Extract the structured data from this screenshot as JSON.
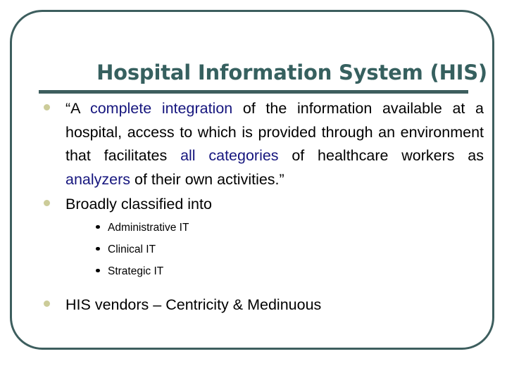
{
  "slide": {
    "title": "Hospital Information System (HIS)",
    "frame_color": "#3d5e5e",
    "title_color": "#36605f",
    "bullet_color": "#cccc99",
    "highlight_color": "#16167e",
    "body_color": "#000000",
    "background_color": "#ffffff"
  },
  "quote": {
    "open_quote": "“A ",
    "hl_complete_integration": "complete integration",
    "mid_1": " of the information available at a hospital, access to which is provided through an environment that facilitates ",
    "hl_all_categories": "all categories",
    "mid_2": " of healthcare workers as ",
    "hl_analyzers": "analyzers",
    "tail": " of their own activities.”"
  },
  "bullets": {
    "classified": "Broadly classified into",
    "vendors": "HIS vendors – Centricity & Medinuous"
  },
  "sub_items": [
    {
      "label": "Administrative IT"
    },
    {
      "label": "Clinical IT"
    },
    {
      "label": "Strategic IT"
    }
  ]
}
